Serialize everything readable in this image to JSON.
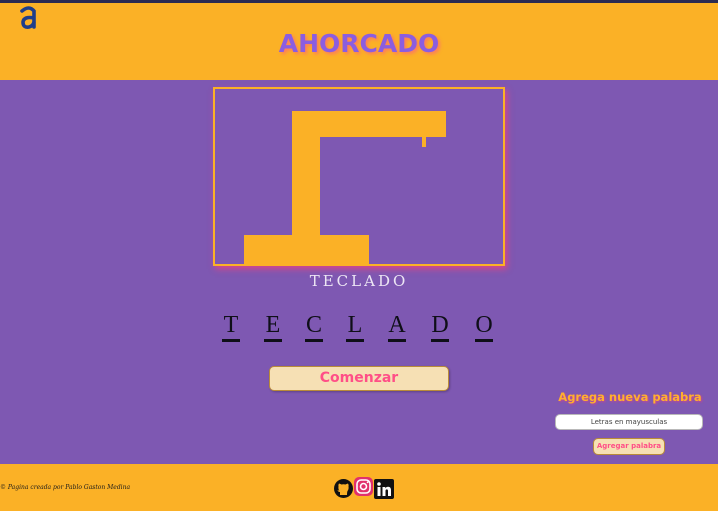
{
  "header": {
    "title": "AHORCADO",
    "logo_icon": "alura-a-logo-icon"
  },
  "game": {
    "hint": "TECLADO",
    "word_letters": [
      "T",
      "E",
      "C",
      "L",
      "A",
      "D",
      "O"
    ]
  },
  "actions": {
    "start_label": "Comenzar"
  },
  "add_word": {
    "title": "Agrega nueva palabra",
    "input_placeholder": "Letras en mayusculas",
    "button_label": "Agregar palabra"
  },
  "footer": {
    "credit": "© Pagina creada por Pablo Gaston Medina",
    "social_icons": [
      "github-icon",
      "instagram-icon",
      "linkedin-icon"
    ]
  },
  "colors": {
    "background": "#7e58b2",
    "header_bar": "#fbb126",
    "title": "#8b5de0",
    "button_bg": "#f6e0b4",
    "button_text": "#ff4f87"
  }
}
